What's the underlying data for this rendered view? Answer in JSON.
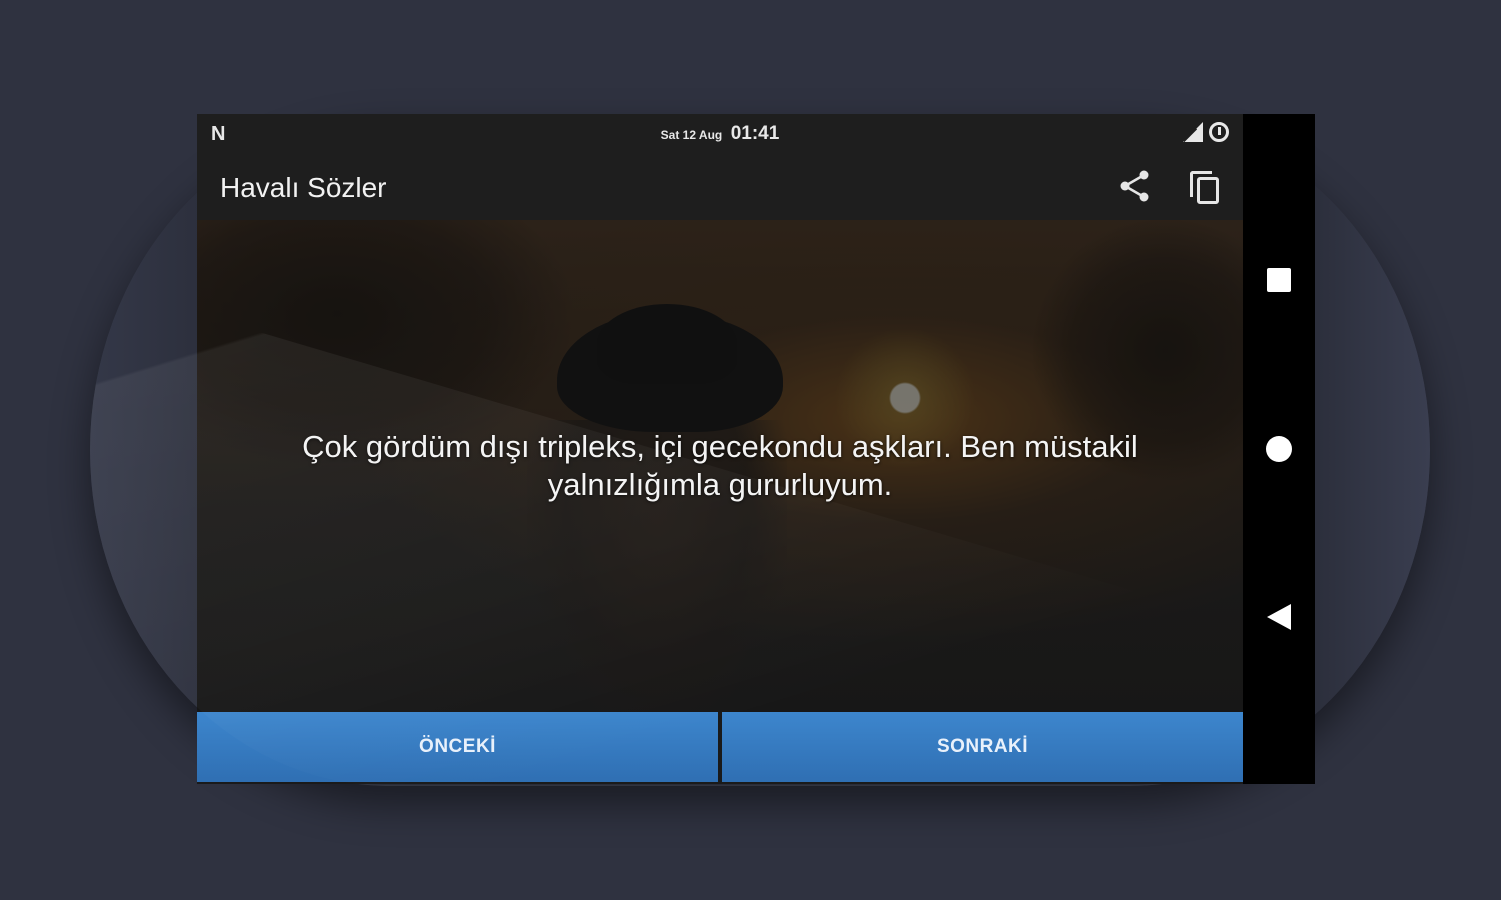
{
  "status_bar": {
    "left_icon": "N",
    "date": "Sat 12 Aug",
    "time": "01:41",
    "icons": [
      "signal-icon",
      "alarm-icon"
    ]
  },
  "toolbar": {
    "title": "Havalı Sözler",
    "actions": [
      "share-icon",
      "copy-icon"
    ]
  },
  "content": {
    "quote": "Çok gördüm dışı tripleks, içi gecekondu aşkları. Ben müstakil yalnızlığımla gururluyum."
  },
  "buttons": {
    "previous": "ÖNCEKİ",
    "next": "SONRAKİ"
  },
  "navigation": {
    "items": [
      "recents-button",
      "home-button",
      "back-button"
    ]
  },
  "colors": {
    "background": "#2f3240",
    "toolbar": "#1e1e1e",
    "button": "#3d86cd"
  }
}
